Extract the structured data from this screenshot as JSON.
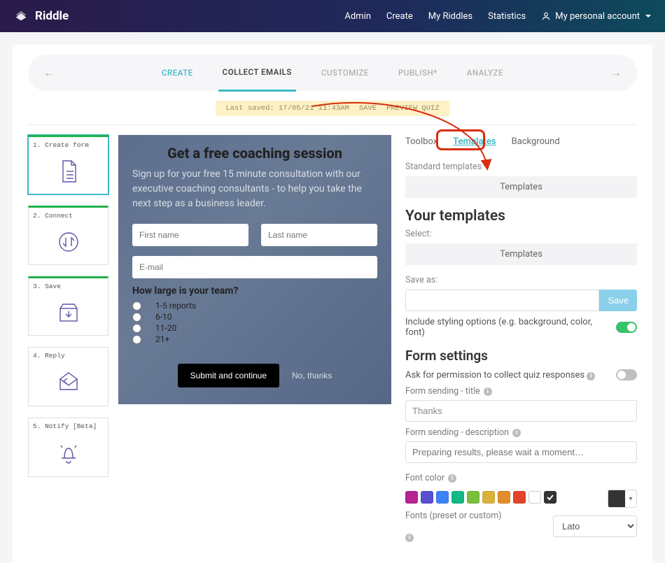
{
  "nav": {
    "brand": "Riddle",
    "links": [
      "Admin",
      "Create",
      "My Riddles",
      "Statistics"
    ],
    "account_label": "My personal account"
  },
  "stepper": {
    "items": [
      "CREATE",
      "COLLECT EMAILS",
      "CUSTOMIZE",
      "PUBLISH*",
      "ANALYZE"
    ],
    "active_index": 1
  },
  "savebar": {
    "last_saved": "Last saved: 17/05/21 11:43AM",
    "save": "SAVE",
    "preview": "PREVIEW QUIZ"
  },
  "side_steps": [
    {
      "label": "1. Create form",
      "icon": "document"
    },
    {
      "label": "2. Connect",
      "icon": "sync"
    },
    {
      "label": "3. Save",
      "icon": "box-down"
    },
    {
      "label": "4. Reply",
      "icon": "envelope-arrow"
    },
    {
      "label": "5. Notify [Beta]",
      "icon": "bell"
    }
  ],
  "preview": {
    "headline": "Get a free coaching session",
    "subtext": "Sign up for your free 15 minute consultation with our executive coaching consultants - to help you take the next step as a business leader.",
    "first_name_placeholder": "First name",
    "last_name_placeholder": "Last name",
    "email_placeholder": "E-mail",
    "question": "How large is your team?",
    "options": [
      "1-5 reports",
      "6-10",
      "11-20",
      "21+"
    ],
    "submit_label": "Submit and continue",
    "no_thanks_label": "No, thanks"
  },
  "right": {
    "tabs": [
      "Toolbox",
      "Templates",
      "Background"
    ],
    "active_tab": 1,
    "std_templates_label": "Standard templates",
    "templates_pill": "Templates",
    "your_templates_heading": "Your templates",
    "select_label": "Select:",
    "templates_pill2": "Templates",
    "save_as_label": "Save as:",
    "save_btn": "Save",
    "include_styling_label": "Include styling options (e.g. background, color, font)",
    "form_settings_heading": "Form settings",
    "permission_label": "Ask for permission to collect quiz responses",
    "sending_title_label": "Form sending - title",
    "sending_title_value": "Thanks",
    "sending_desc_label": "Form sending - description",
    "sending_desc_placeholder": "Preparing results, please wait a moment…",
    "font_color_label": "Font color",
    "swatches": [
      "#b5248f",
      "#5a4fcf",
      "#3b82f6",
      "#12b886",
      "#7bbf3c",
      "#d9b23c",
      "#e08e2b",
      "#e0452b",
      "#ffffff",
      "#333333"
    ],
    "selected_swatch_index": 9,
    "current_color": "#333333",
    "fonts_label": "Fonts (preset or custom)",
    "font_value": "Lato"
  }
}
